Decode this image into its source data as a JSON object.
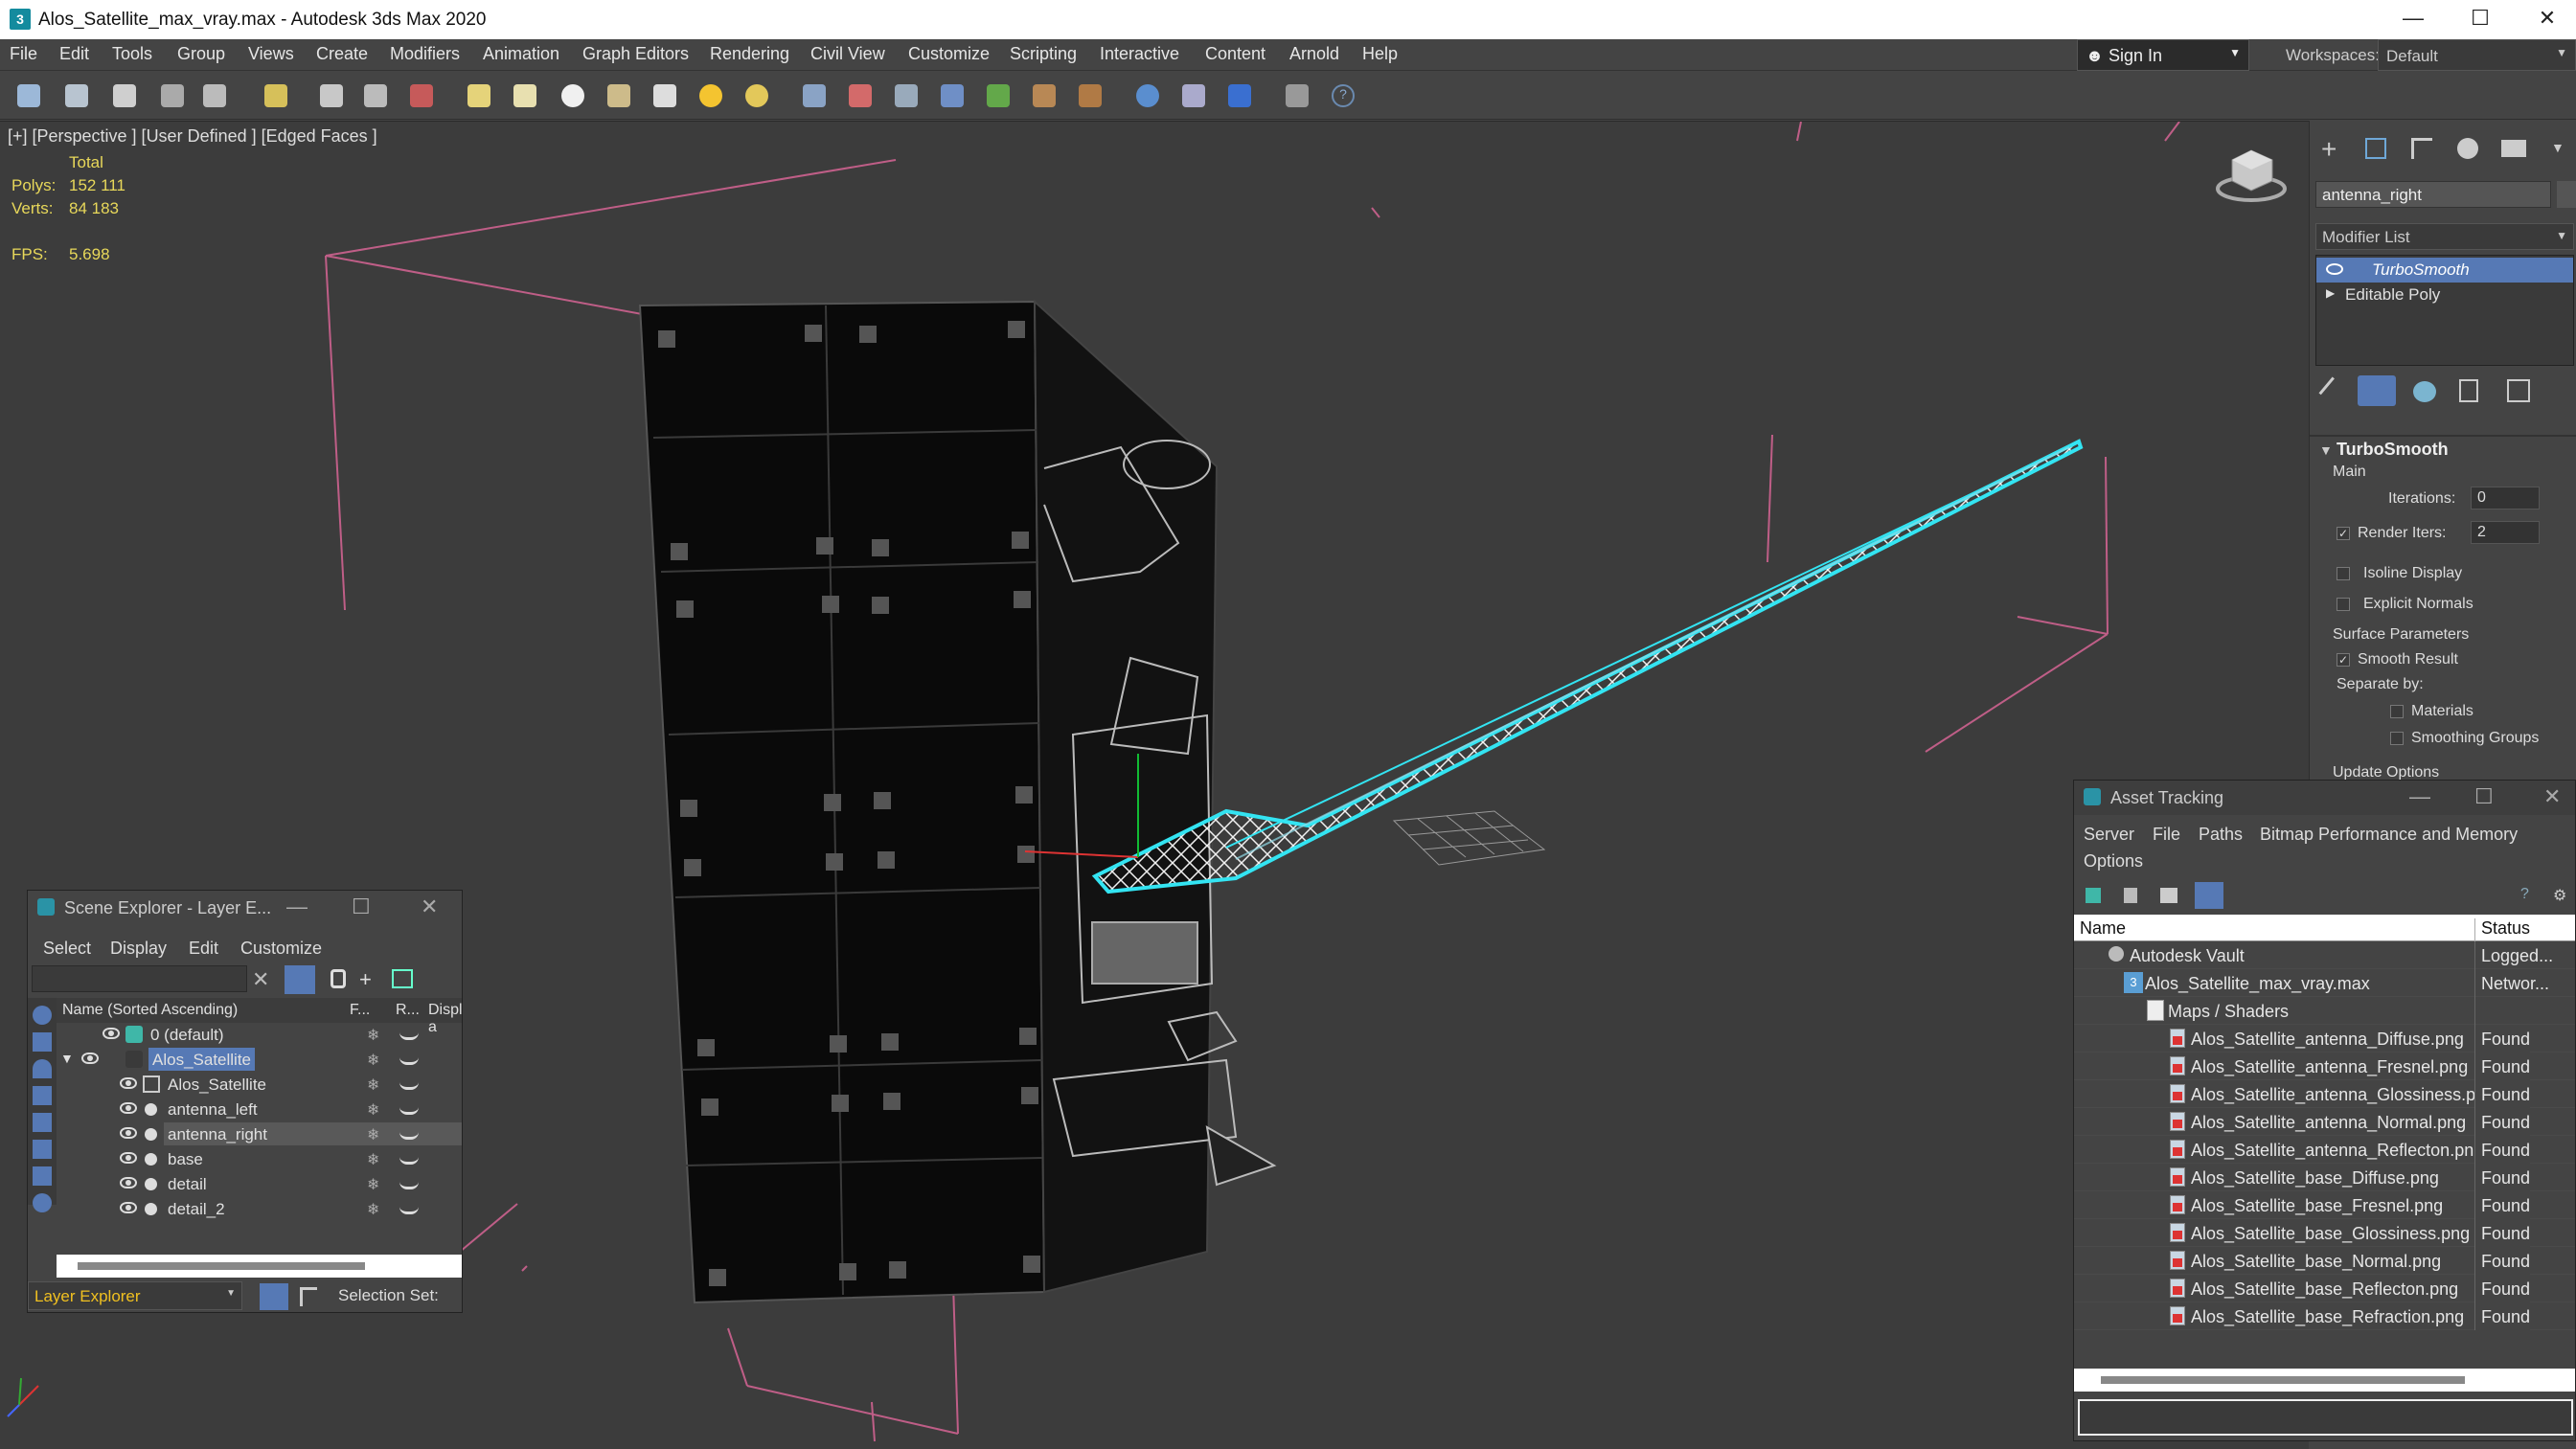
{
  "window": {
    "title": "Alos_Satellite_max_vray.max - Autodesk 3ds Max 2020",
    "app_icon": "3"
  },
  "menu": [
    "File",
    "Edit",
    "Tools",
    "Group",
    "Views",
    "Create",
    "Modifiers",
    "Animation",
    "Graph Editors",
    "Rendering",
    "Civil View",
    "Customize",
    "Scripting",
    "Interactive",
    "Content",
    "Arnold",
    "Help"
  ],
  "signin": {
    "label": "Sign In"
  },
  "workspaces": {
    "label": "Workspaces:",
    "value": "Default"
  },
  "viewport": {
    "label": "[+] [Perspective ] [User Defined ] [Edged Faces ]",
    "stats": {
      "total": "Total",
      "polys_label": "Polys:",
      "polys": "152 111",
      "verts_label": "Verts:",
      "verts": "84 183",
      "fps_label": "FPS:",
      "fps": "5.698"
    },
    "selection_color": "#33e4f2",
    "box_color": "#e0679a"
  },
  "command_panel": {
    "object_name": "antenna_right",
    "modifier_list": "Modifier List",
    "stack": [
      "TurboSmooth",
      "Editable Poly"
    ],
    "rollout": {
      "title": "TurboSmooth",
      "main": "Main",
      "iterations_label": "Iterations:",
      "iterations": "0",
      "render_iters_label": "Render Iters:",
      "render_iters": "2",
      "isoline": "Isoline Display",
      "explicit_normals": "Explicit Normals",
      "surface_params": "Surface Parameters",
      "smooth_result": "Smooth Result",
      "separate_by": "Separate by:",
      "materials": "Materials",
      "smoothing_groups": "Smoothing Groups",
      "update_options": "Update Options"
    }
  },
  "scene_explorer": {
    "title": "Scene Explorer - Layer E...",
    "menu": [
      "Select",
      "Display",
      "Edit",
      "Customize"
    ],
    "columns": {
      "name": "Name (Sorted Ascending)",
      "f": "F...",
      "r": "R...",
      "display": "Display a"
    },
    "rows": [
      {
        "label": "0 (default)"
      },
      {
        "label": "Alos_Satellite"
      },
      {
        "label": "Alos_Satellite"
      },
      {
        "label": "antenna_left"
      },
      {
        "label": "antenna_right"
      },
      {
        "label": "base"
      },
      {
        "label": "detail"
      },
      {
        "label": "detail_2"
      }
    ],
    "footer": {
      "mode": "Layer Explorer",
      "selection_set": "Selection Set:"
    }
  },
  "asset_tracking": {
    "title": "Asset Tracking",
    "menu": [
      "Server",
      "File",
      "Paths",
      "Bitmap Performance and Memory",
      "Options"
    ],
    "columns": {
      "name": "Name",
      "status": "Status"
    },
    "rows": [
      {
        "name": "Autodesk Vault",
        "status": "Logged..."
      },
      {
        "name": "Alos_Satellite_max_vray.max",
        "status": "Networ..."
      },
      {
        "name": "Maps / Shaders",
        "status": ""
      },
      {
        "name": "Alos_Satellite_antenna_Diffuse.png",
        "status": "Found"
      },
      {
        "name": "Alos_Satellite_antenna_Fresnel.png",
        "status": "Found"
      },
      {
        "name": "Alos_Satellite_antenna_Glossiness.png",
        "status": "Found"
      },
      {
        "name": "Alos_Satellite_antenna_Normal.png",
        "status": "Found"
      },
      {
        "name": "Alos_Satellite_antenna_Reflecton.png",
        "status": "Found"
      },
      {
        "name": "Alos_Satellite_base_Diffuse.png",
        "status": "Found"
      },
      {
        "name": "Alos_Satellite_base_Fresnel.png",
        "status": "Found"
      },
      {
        "name": "Alos_Satellite_base_Glossiness.png",
        "status": "Found"
      },
      {
        "name": "Alos_Satellite_base_Normal.png",
        "status": "Found"
      },
      {
        "name": "Alos_Satellite_base_Reflecton.png",
        "status": "Found"
      },
      {
        "name": "Alos_Satellite_base_Refraction.png",
        "status": "Found"
      }
    ]
  }
}
